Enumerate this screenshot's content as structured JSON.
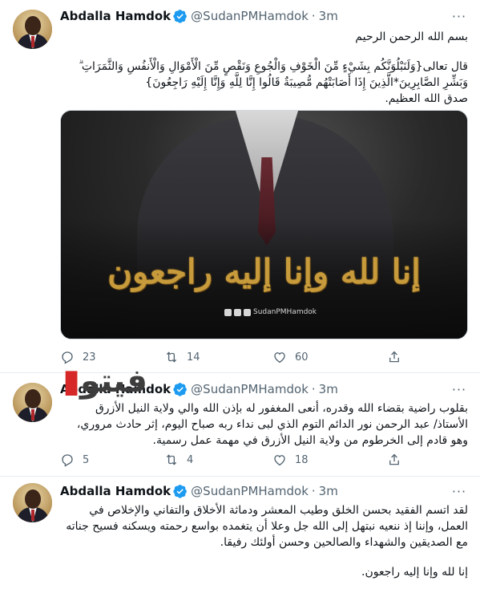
{
  "account": {
    "name": "Abdalla Hamdok",
    "handle": "@SudanPMHamdok",
    "verified_color": "#1d9bf0"
  },
  "tweets": [
    {
      "time": "3m",
      "paragraphs": [
        "بسم الله الرحمن الرحيم",
        "قال تعالى{وَلَنَبْلُوَنَّكُم بِشَيْءٍ مِّنَ الْخَوْفِ وَالْجُوعِ وَنَقْصٍ مِّنَ الْأَمْوَالِ وَالْأَنفُسِ وَالثَّمَرَاتِ ۗ وَبَشِّرِ الصَّابِرِينَ*الَّذِينَ إِذَا أَصَابَتْهُم مُّصِيبَةٌ قَالُوا إِنَّا لِلَّهِ وَإِنَّا إِلَيْهِ رَاجِعُونَ}",
        "صدق الله العظيم."
      ],
      "media": {
        "calligraphy": "إنا لله وإنا إليه راجعون",
        "social_handle": "SudanPMHamdok",
        "social_icons": [
          "facebook-icon",
          "twitter-icon",
          "instagram-icon"
        ]
      },
      "replies": "23",
      "retweets": "14",
      "likes": "60"
    },
    {
      "time": "3m",
      "paragraphs": [
        "بقلوب راضية بقضاء الله وقدره، أنعى المغفور له بإذن الله والي ولاية النيل الأزرق الأستاذ/ عبد الرحمن نور الدائم التوم الذي لبى نداء ربه صباح اليوم، إثر حادث مروري، وهو قادم إلى الخرطوم من ولاية النيل الأزرق في مهمة عمل رسمية."
      ],
      "replies": "5",
      "retweets": "4",
      "likes": "18"
    },
    {
      "time": "3m",
      "paragraphs": [
        "لقد اتسم الفقيد بحسن الخلق وطيب المعشر ودماثة الأخلاق والتفاني والإخلاص في العمل، وإننا إذ ننعيه نبتهل إلى الله جل وعلا أن يتغمده بواسع رحمته ويسكنه فسيح جناته مع الصديقين والشهداء والصالحين وحسن أولئك رفيقا.",
        "إنا لله وإنا إليه راجعون."
      ]
    }
  ],
  "watermark": {
    "text_main": "فيتو",
    "accent_color": "#d62828"
  },
  "icons": {
    "more": "more-dots-icon",
    "reply": "reply-icon",
    "retweet": "retweet-icon",
    "like": "heart-icon",
    "share": "share-icon"
  }
}
